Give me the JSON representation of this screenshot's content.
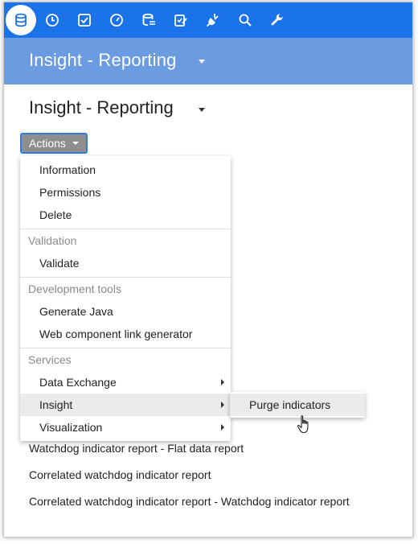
{
  "banner": {
    "title": "Insight - Reporting"
  },
  "page": {
    "title": "Insight - Reporting"
  },
  "actions_button": {
    "label": "Actions"
  },
  "menu": {
    "items": [
      {
        "label": "Information"
      },
      {
        "label": "Permissions"
      },
      {
        "label": "Delete"
      }
    ],
    "sections": [
      {
        "header": "Validation",
        "items": [
          {
            "label": "Validate"
          }
        ]
      },
      {
        "header": "Development tools",
        "items": [
          {
            "label": "Generate Java"
          },
          {
            "label": "Web component link generator"
          }
        ]
      },
      {
        "header": "Services",
        "items": [
          {
            "label": "Data Exchange"
          },
          {
            "label": "Insight"
          },
          {
            "label": "Visualization"
          }
        ]
      }
    ]
  },
  "submenu": {
    "items": [
      {
        "label": "Purge indicators"
      }
    ]
  },
  "reports": [
    {
      "label": "Watchdog indicator report - Flat data report"
    },
    {
      "label": "Correlated watchdog indicator report"
    },
    {
      "label": "Correlated watchdog indicator report - Watchdog indicator report"
    }
  ],
  "colors": {
    "topbar": "#1a73e8",
    "banner": "#6b9be0",
    "actions_button": "#8e8e8e",
    "highlight": "#ebebeb"
  },
  "toolbar_icons": [
    "database-icon",
    "clock-icon",
    "checkbox-icon",
    "speedometer-icon",
    "database-list-icon",
    "edit-checklist-icon",
    "plug-icon",
    "search-icon",
    "wrench-icon"
  ]
}
